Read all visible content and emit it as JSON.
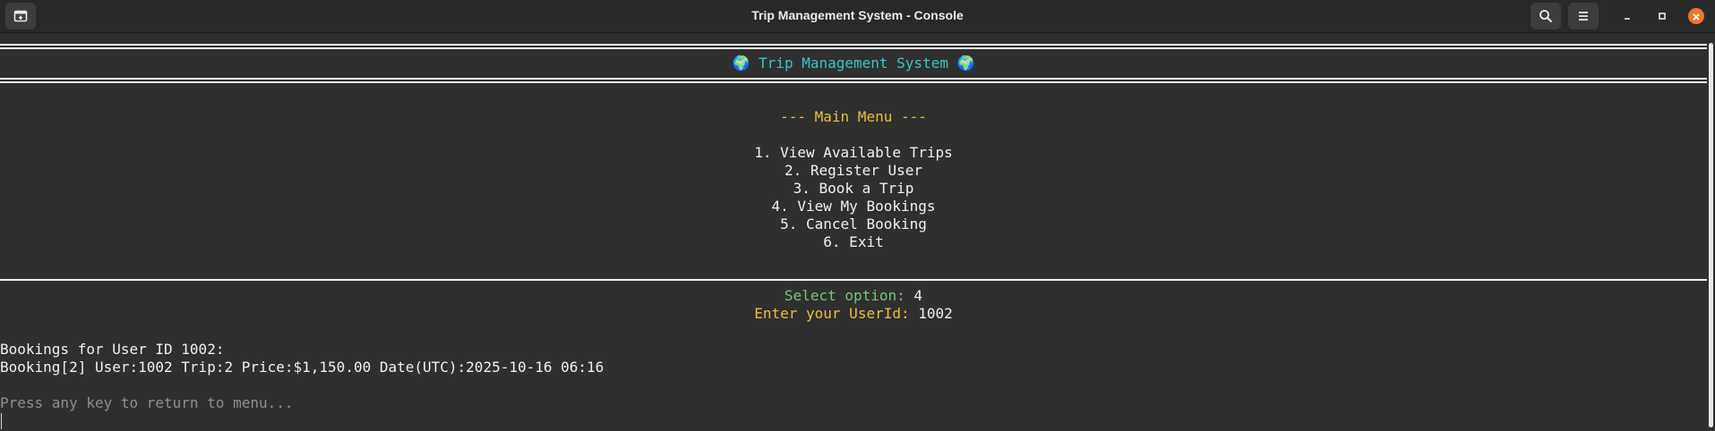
{
  "window": {
    "title": "Trip Management System - Console"
  },
  "icons": {
    "new_tab": "new-tab-icon",
    "search": "search-icon",
    "menu": "hamburger-menu-icon",
    "minimize": "minimize-icon",
    "maximize": "maximize-icon",
    "close": "close-icon"
  },
  "colors": {
    "background": "#2f2f2f",
    "heading": "#36c5c4",
    "menu_title": "#eabf3c",
    "prompt": "#74c47a",
    "close_button": "#e9782f"
  },
  "console": {
    "header": "🌍 Trip Management System 🌍",
    "menu_title": "--- Main Menu ---",
    "menu_items": [
      "1. View Available Trips",
      "2. Register User",
      "3. Book a Trip",
      "4. View My Bookings",
      "5. Cancel Booking",
      "6. Exit"
    ],
    "select_prompt": "Select option:",
    "select_value": "4",
    "userid_prompt": "Enter your UserId:",
    "userid_value": "1002",
    "bookings_heading": "Bookings for User ID 1002:",
    "booking_lines": [
      "Booking[2] User:1002 Trip:2 Price:$1,150.00 Date(UTC):2025-10-16 06:16"
    ],
    "footer": "Press any key to return to menu..."
  }
}
